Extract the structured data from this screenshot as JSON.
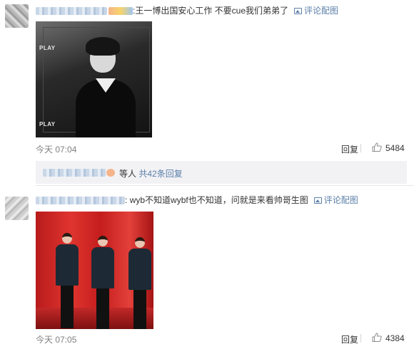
{
  "comments": [
    {
      "colon": ":",
      "text": "王一博出国安心工作 不要cue我们弟弟了",
      "pic_link": "评论配图",
      "photo_caption_top": "PLAY",
      "photo_caption_bottom": "PLAY",
      "time": "今天 07:04",
      "reply_label": "回复",
      "likes": "5484"
    },
    {
      "colon": ":",
      "text": "wyb不知道wybf也不知道，问就是来看帅哥生图",
      "pic_link": "评论配图",
      "time": "今天 07:05",
      "reply_label": "回复",
      "likes": "4384"
    }
  ],
  "replies_summary": {
    "prefix": "等人",
    "link": "共42条回复"
  },
  "colors": {
    "link": "#5b7fa8",
    "muted": "#808080",
    "reply_bg": "#f2f2f5"
  }
}
